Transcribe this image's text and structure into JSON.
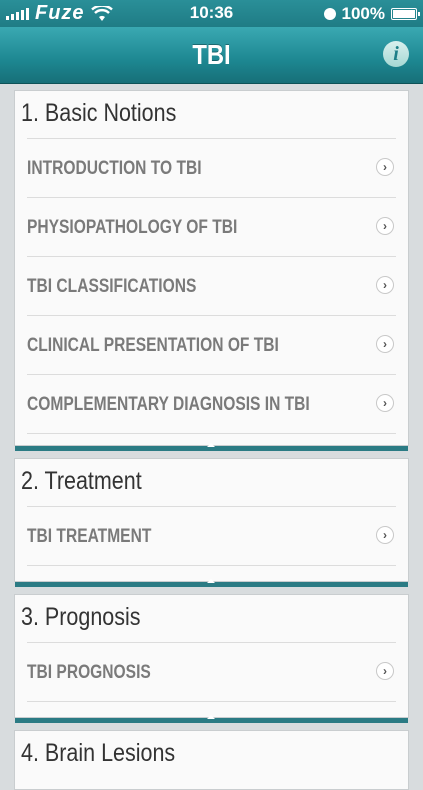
{
  "status_bar": {
    "carrier": "Fuze",
    "time": "10:36",
    "battery": "100%"
  },
  "nav": {
    "title": "TBI",
    "info_label": "i"
  },
  "sections": [
    {
      "title": "1. Basic Notions",
      "items": [
        "INTRODUCTION TO TBI",
        "PHYSIOPATHOLOGY OF TBI",
        "TBI CLASSIFICATIONS",
        "CLINICAL PRESENTATION OF TBI",
        "COMPLEMENTARY DIAGNOSIS IN TBI"
      ]
    },
    {
      "title": "2. Treatment",
      "items": [
        "TBI TREATMENT"
      ]
    },
    {
      "title": "3. Prognosis",
      "items": [
        "TBI PROGNOSIS"
      ]
    },
    {
      "title": "4. Brain Lesions",
      "items": []
    }
  ],
  "colors": {
    "accent": "#1f7c85",
    "section_bar": "#2b7b84"
  }
}
